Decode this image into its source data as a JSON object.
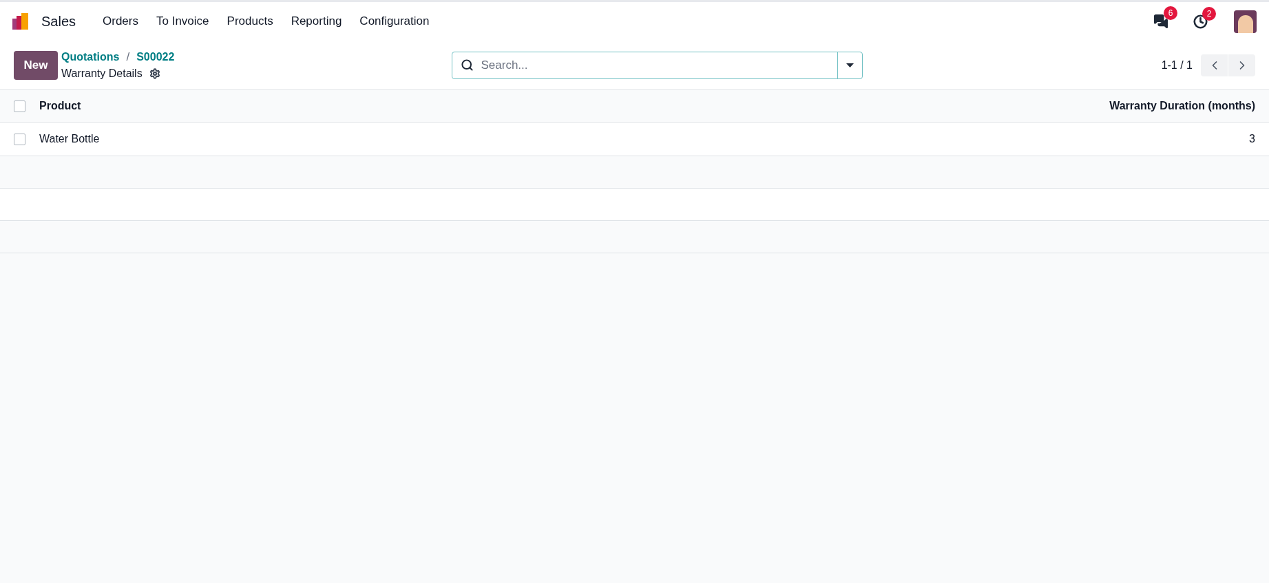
{
  "navbar": {
    "app_name": "Sales",
    "menu": [
      "Orders",
      "To Invoice",
      "Products",
      "Reporting",
      "Configuration"
    ],
    "messages_badge": "6",
    "activities_badge": "2"
  },
  "control_panel": {
    "new_button": "New",
    "breadcrumbs": [
      "Quotations",
      "S00022"
    ],
    "breadcrumb_separator": "/",
    "title": "Warranty Details",
    "search": {
      "placeholder": "Search..."
    },
    "pager": "1-1 / 1"
  },
  "table": {
    "columns": [
      {
        "label": "Product"
      },
      {
        "label": "Warranty Duration (months)"
      }
    ],
    "select_all_checked": false,
    "rows": [
      {
        "checked": false,
        "cells": [
          "Water Bottle",
          "3"
        ]
      }
    ]
  }
}
